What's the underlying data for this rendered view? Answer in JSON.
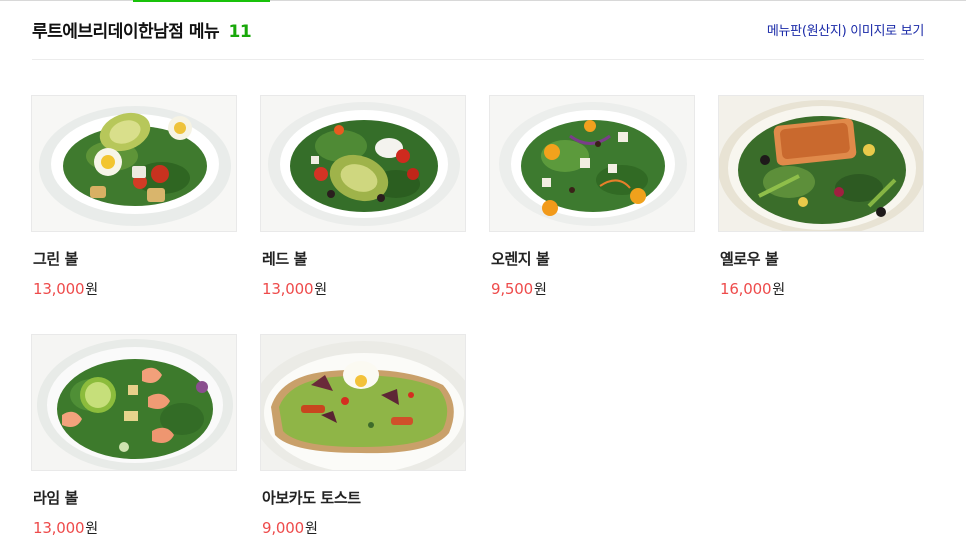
{
  "header": {
    "store_title": "루트에브리데이한남점 메뉴",
    "menu_count": "11",
    "view_board_link": "메뉴판(원산지) 이미지로 보기"
  },
  "menu_items": [
    {
      "name": "그린 볼",
      "price": "13,000",
      "unit": "원"
    },
    {
      "name": "레드 볼",
      "price": "13,000",
      "unit": "원"
    },
    {
      "name": "오렌지 볼",
      "price": "9,500",
      "unit": "원"
    },
    {
      "name": "옐로우 볼",
      "price": "16,000",
      "unit": "원"
    },
    {
      "name": "라임 볼",
      "price": "13,000",
      "unit": "원"
    },
    {
      "name": "아보카도 토스트",
      "price": "9,000",
      "unit": "원"
    }
  ]
}
